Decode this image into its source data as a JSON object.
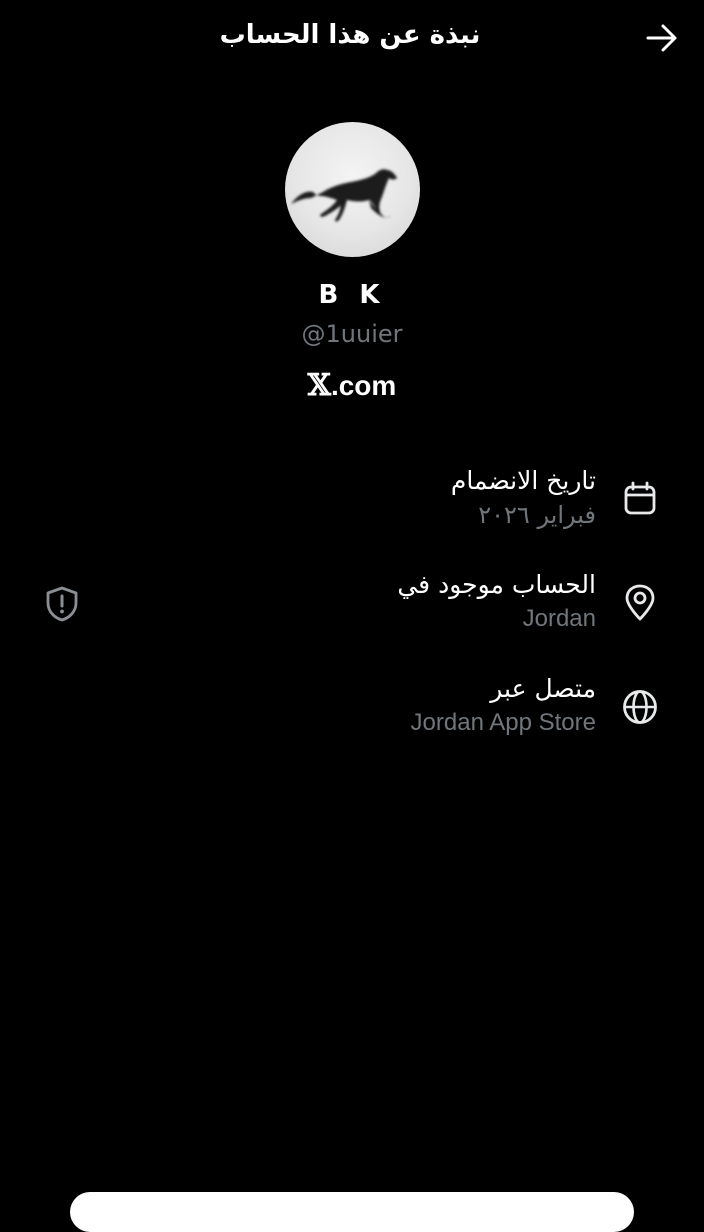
{
  "header": {
    "title": "نبذة عن هذا الحساب",
    "back_icon": "arrow-right-icon"
  },
  "profile": {
    "display_name": "B K",
    "handle": "@1uuier",
    "site_symbol": "𝕏",
    "site_suffix": ".com"
  },
  "info": [
    {
      "icon": "calendar-icon",
      "label": "تاريخ الانضمام",
      "value": "فبراير ٢٠٢٦"
    },
    {
      "icon": "location-pin-icon",
      "label": "الحساب موجود في",
      "value": "Jordan"
    },
    {
      "icon": "globe-icon",
      "label": "متصل عبر",
      "value": "Jordan App Store"
    }
  ],
  "colors": {
    "background": "#000000",
    "primary_text": "#ffffff",
    "secondary_text": "#71767b"
  }
}
